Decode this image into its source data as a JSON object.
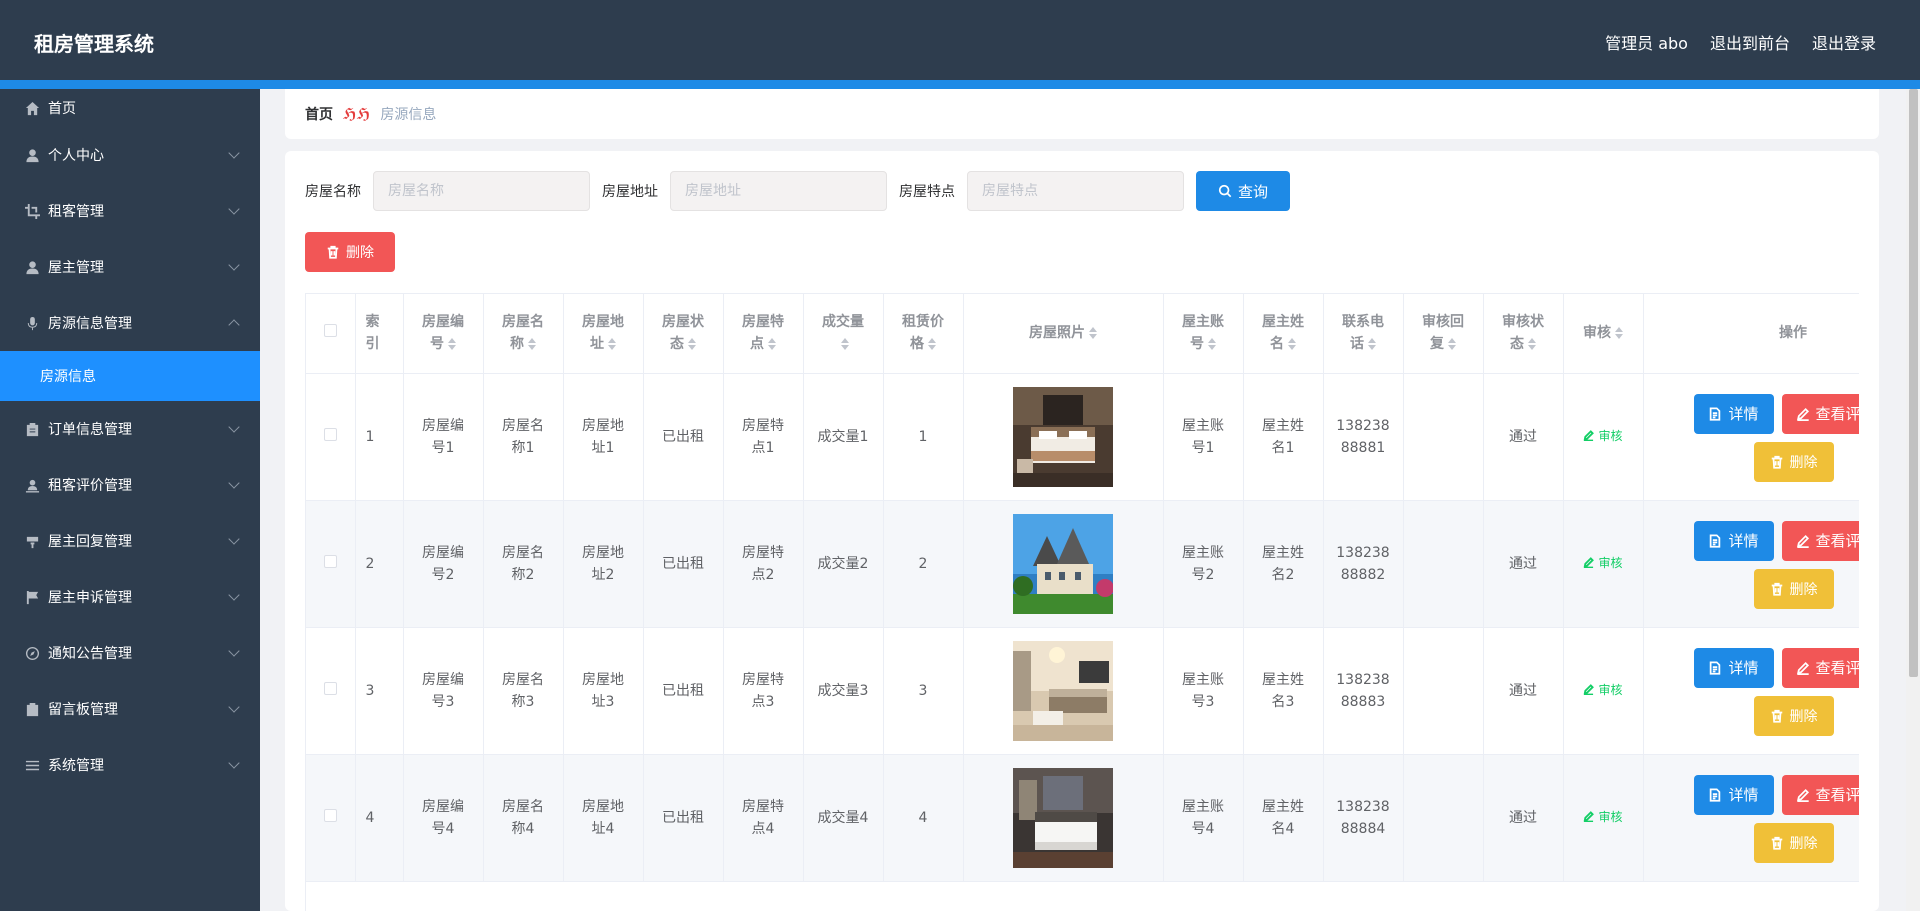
{
  "header": {
    "brand": "租房管理系统",
    "admin": "管理员 abo",
    "to_front": "退出到前台",
    "logout": "退出登录"
  },
  "sidebar": {
    "items": [
      {
        "label": "首页",
        "icon": "home-icon"
      },
      {
        "label": "个人中心",
        "icon": "user-icon"
      },
      {
        "label": "租客管理",
        "icon": "crop-icon"
      },
      {
        "label": "屋主管理",
        "icon": "user-icon"
      },
      {
        "label": "房源信息管理",
        "icon": "microphone-icon"
      },
      {
        "label": "订单信息管理",
        "icon": "clipboard-icon"
      },
      {
        "label": "租客评价管理",
        "icon": "user-stand-icon"
      },
      {
        "label": "屋主回复管理",
        "icon": "platter-icon"
      },
      {
        "label": "屋主申诉管理",
        "icon": "flag-icon"
      },
      {
        "label": "通知公告管理",
        "icon": "compass-icon"
      },
      {
        "label": "留言板管理",
        "icon": "delete-box-icon"
      },
      {
        "label": "系统管理",
        "icon": "menu-icon"
      }
    ],
    "sub_active": "房源信息"
  },
  "breadcrumb": {
    "home": "首页",
    "current": "房源信息"
  },
  "search": {
    "name_label": "房屋名称",
    "name_placeholder": "房屋名称",
    "address_label": "房屋地址",
    "address_placeholder": "房屋地址",
    "feature_label": "房屋特点",
    "feature_placeholder": "房屋特点",
    "query_label": "查询"
  },
  "toolbar": {
    "delete_label": "删除"
  },
  "table": {
    "headers": [
      "索引",
      "房屋编号",
      "房屋名称",
      "房屋地址",
      "房屋状态",
      "房屋特点",
      "成交量",
      "租赁价格",
      "房屋照片",
      "屋主账号",
      "屋主姓名",
      "联系电话",
      "审核回复",
      "审核状态",
      "审核",
      "操作"
    ],
    "header_lines": {
      "index": [
        "索",
        "引"
      ],
      "code": [
        "房屋编",
        "号"
      ],
      "name": [
        "房屋名",
        "称"
      ],
      "address": [
        "房屋地",
        "址"
      ],
      "status": [
        "房屋状",
        "态"
      ],
      "feature": [
        "房屋特",
        "点"
      ],
      "deals": [
        "成交量",
        ""
      ],
      "price": [
        "租赁价",
        "格"
      ],
      "photo": "房屋照片",
      "owner_acc": [
        "屋主账",
        "号"
      ],
      "owner_name": [
        "屋主姓",
        "名"
      ],
      "phone": [
        "联系电",
        "话"
      ],
      "reply": [
        "审核回",
        "复"
      ],
      "audit_status": [
        "审核状",
        "态"
      ],
      "audit": "审核",
      "ops": "操作"
    },
    "rows": [
      {
        "index": "1",
        "code": [
          "房屋编",
          "号1"
        ],
        "name": [
          "房屋名",
          "称1"
        ],
        "address": [
          "房屋地",
          "址1"
        ],
        "status": "已出租",
        "feature": [
          "房屋特",
          "点1"
        ],
        "deals": "成交量1",
        "price": "1",
        "owner_acc": [
          "屋主账",
          "号1"
        ],
        "owner_name": [
          "屋主姓",
          "名1"
        ],
        "phone": [
          "138238",
          "88881"
        ],
        "reply": "",
        "audit_status": "通过"
      },
      {
        "index": "2",
        "code": [
          "房屋编",
          "号2"
        ],
        "name": [
          "房屋名",
          "称2"
        ],
        "address": [
          "房屋地",
          "址2"
        ],
        "status": "已出租",
        "feature": [
          "房屋特",
          "点2"
        ],
        "deals": "成交量2",
        "price": "2",
        "owner_acc": [
          "屋主账",
          "号2"
        ],
        "owner_name": [
          "屋主姓",
          "名2"
        ],
        "phone": [
          "138238",
          "88882"
        ],
        "reply": "",
        "audit_status": "通过"
      },
      {
        "index": "3",
        "code": [
          "房屋编",
          "号3"
        ],
        "name": [
          "房屋名",
          "称3"
        ],
        "address": [
          "房屋地",
          "址3"
        ],
        "status": "已出租",
        "feature": [
          "房屋特",
          "点3"
        ],
        "deals": "成交量3",
        "price": "3",
        "owner_acc": [
          "屋主账",
          "号3"
        ],
        "owner_name": [
          "屋主姓",
          "名3"
        ],
        "phone": [
          "138238",
          "88883"
        ],
        "reply": "",
        "audit_status": "通过"
      },
      {
        "index": "4",
        "code": [
          "房屋编",
          "号4"
        ],
        "name": [
          "房屋名",
          "称4"
        ],
        "address": [
          "房屋地",
          "址4"
        ],
        "status": "已出租",
        "feature": [
          "房屋特",
          "点4"
        ],
        "deals": "成交量4",
        "price": "4",
        "owner_acc": [
          "屋主账",
          "号4"
        ],
        "owner_name": [
          "屋主姓",
          "名4"
        ],
        "phone": [
          "138238",
          "88884"
        ],
        "reply": "",
        "audit_status": "通过"
      }
    ],
    "audit_link": "审核",
    "detail_label": "详情",
    "review_label": "查看评",
    "row_delete_label": "删除"
  },
  "colors": {
    "header_bg": "#2e3d4e",
    "accent": "#1e8ae6",
    "danger": "#f25656",
    "warning": "#f0c038",
    "success": "#13ce66"
  }
}
